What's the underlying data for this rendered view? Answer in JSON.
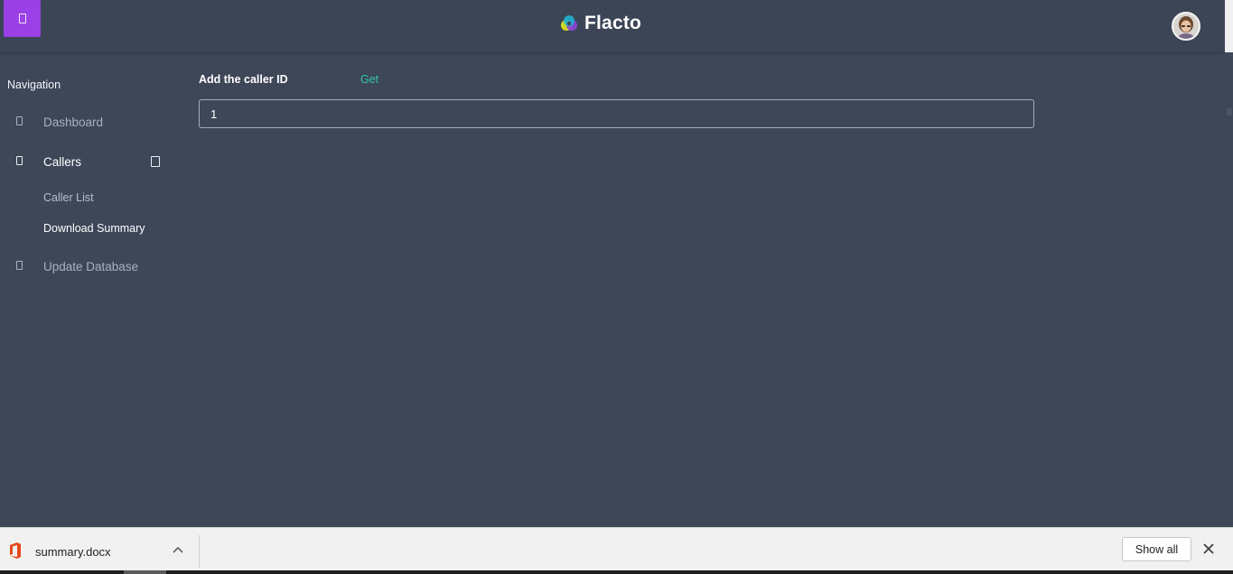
{
  "header": {
    "brand_name": "Flacto",
    "menu_icon": "menu-icon",
    "avatar_icon": "user-avatar"
  },
  "sidebar": {
    "heading": "Navigation",
    "items": [
      {
        "label": "Dashboard",
        "icon": "dashboard-icon",
        "active": false
      },
      {
        "label": "Callers",
        "icon": "callers-icon",
        "active": true,
        "expanded": true,
        "children": [
          {
            "label": "Caller List"
          },
          {
            "label": "Download Summary"
          }
        ]
      },
      {
        "label": "Update Database",
        "icon": "database-icon",
        "active": false
      }
    ]
  },
  "main": {
    "form_label": "Add the caller ID",
    "get_link": "Get",
    "caller_id_value": "1"
  },
  "download_bar": {
    "file_name": "summary.docx",
    "show_all_label": "Show all"
  },
  "colors": {
    "background": "#3d4758",
    "accent_purple": "#9a40e6",
    "link_green": "#2ec4a3",
    "office_red": "#e8481a"
  }
}
